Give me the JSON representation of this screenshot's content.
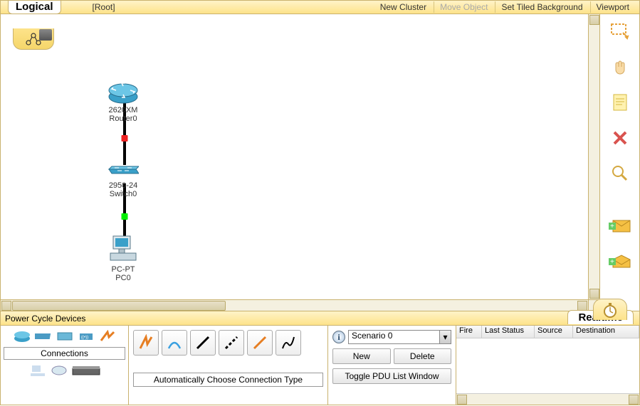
{
  "topbar": {
    "mode": "Logical",
    "root": "[Root]",
    "new_cluster": "New Cluster",
    "move_object": "Move Object",
    "set_bg": "Set Tiled Background",
    "viewport": "Viewport"
  },
  "devices": {
    "router": {
      "type": "2620XM",
      "name": "Router0"
    },
    "switch": {
      "type": "2950-24",
      "name": "Switch0"
    },
    "pc": {
      "type": "PC-PT",
      "name": "PC0"
    }
  },
  "statusbar": {
    "power_cycle": "Power Cycle Devices",
    "realtime": "Realtime"
  },
  "picker": {
    "category": "Connections",
    "conn_desc": "Automatically Choose Connection Type"
  },
  "scenario": {
    "selected": "Scenario 0",
    "new": "New",
    "delete": "Delete",
    "toggle": "Toggle PDU List Window"
  },
  "pdu": {
    "cols": [
      "Fire",
      "Last Status",
      "Source",
      "Destination"
    ]
  }
}
